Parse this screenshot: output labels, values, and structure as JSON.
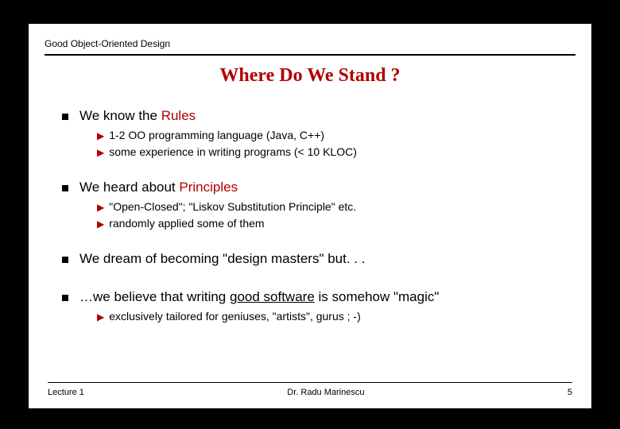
{
  "header": {
    "course": "Good Object-Oriented Design"
  },
  "title": "Where Do We Stand ?",
  "sections": [
    {
      "prefix": "We know the ",
      "accent": "Rules",
      "suffix": "",
      "subs": [
        "1-2 OO programming language (Java, C++)",
        "some experience in writing programs (< 10 KLOC)"
      ]
    },
    {
      "prefix": "We heard about ",
      "accent": "Principles",
      "suffix": "",
      "subs": [
        "\"Open-Closed\"; \"Liskov Substitution Principle\" etc.",
        "randomly applied some of them"
      ]
    },
    {
      "prefix": "We dream of becoming \"design masters\" but. . .",
      "accent": "",
      "suffix": "",
      "subs": []
    },
    {
      "prefix": "…we believe that writing ",
      "underline": "good software",
      "suffix": " is somehow \"magic\"",
      "subs": [
        "exclusively tailored for geniuses, \"artists\", gurus ; -)"
      ]
    }
  ],
  "footer": {
    "left": "Lecture 1",
    "center": "Dr. Radu Marinescu",
    "right": "5"
  }
}
